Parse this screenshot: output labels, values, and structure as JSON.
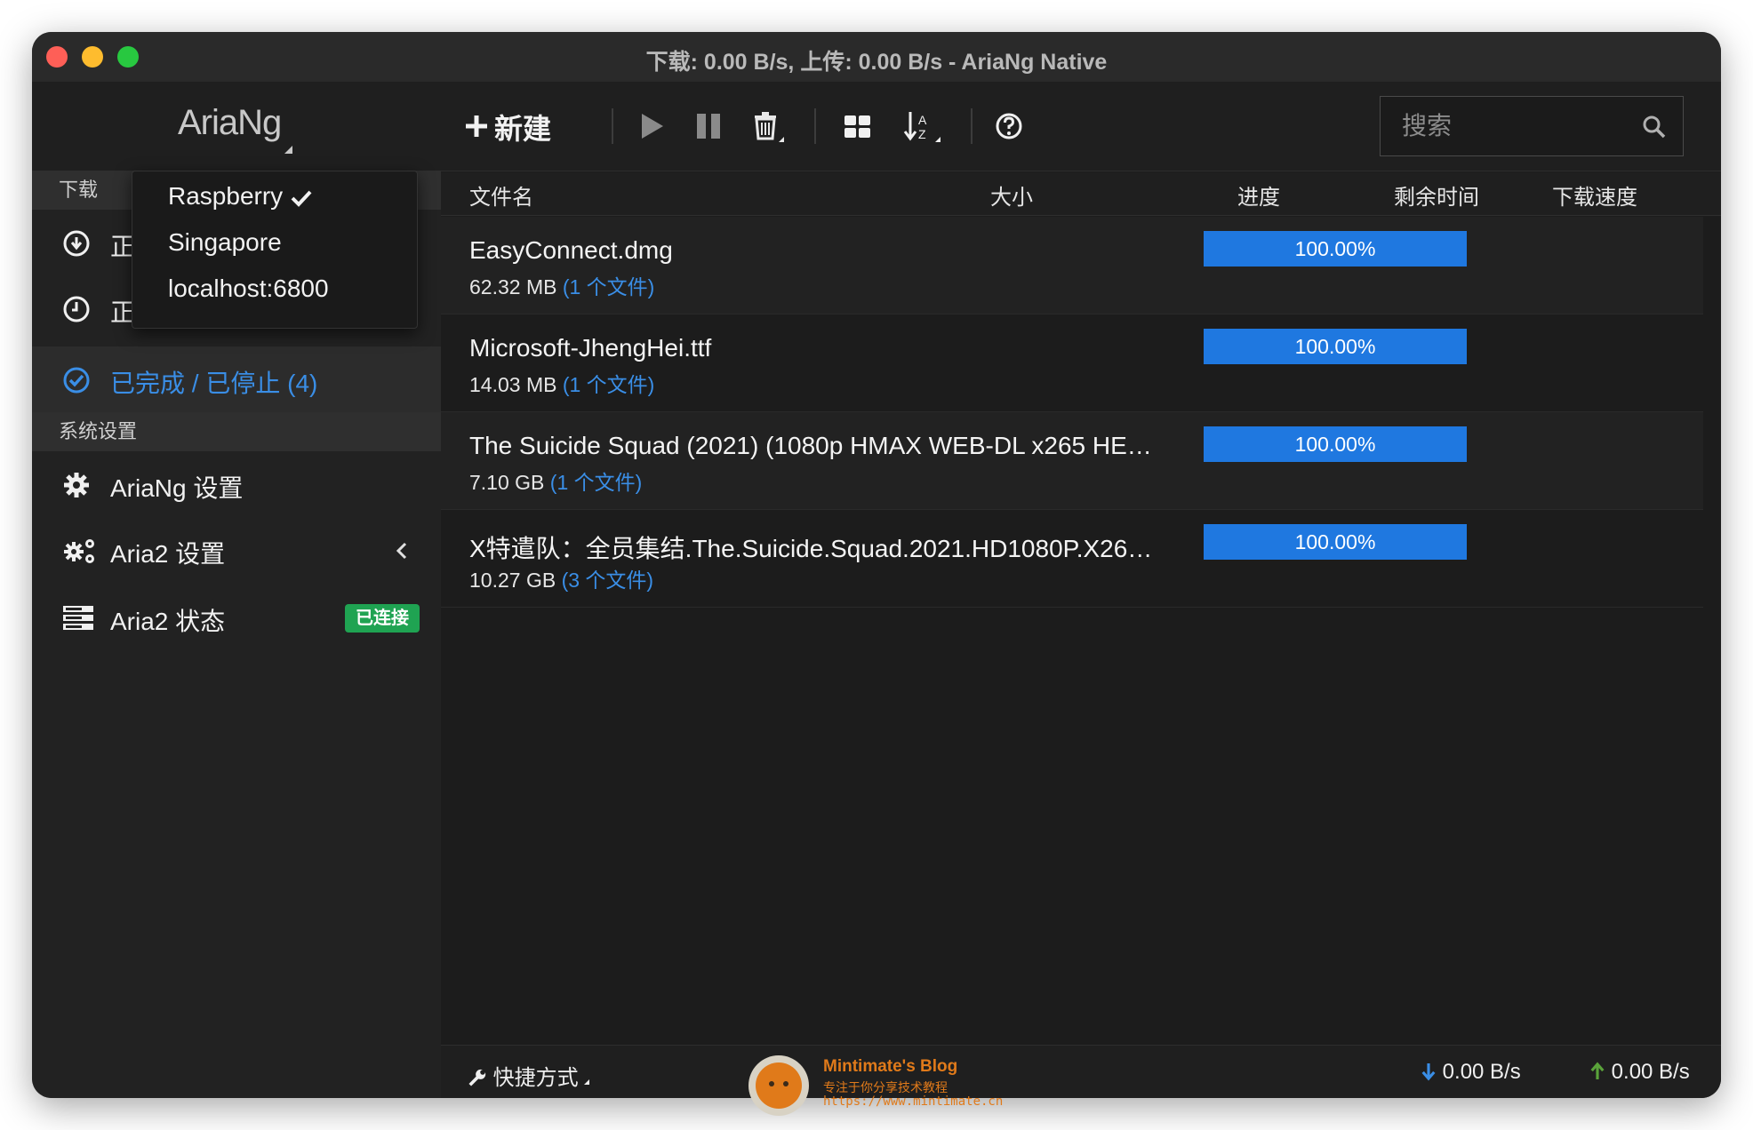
{
  "window": {
    "title": "下载: 0.00 B/s, 上传: 0.00 B/s - AriaNg Native"
  },
  "sidebar": {
    "logo": "AriaNg",
    "download_header": "下载",
    "partial_item_1": "正",
    "partial_item_2": "正",
    "completed_label": "已完成 / 已停止 (4)",
    "settings_header": "系统设置",
    "ariang_settings": "AriaNg 设置",
    "aria2_settings": "Aria2 设置",
    "aria2_status": "Aria2 状态",
    "status_badge": "已连接"
  },
  "rpc_dropdown": {
    "items": [
      "Raspberry",
      "Singapore",
      "localhost:6800"
    ],
    "selected": "Raspberry"
  },
  "toolbar": {
    "new_label": "新建",
    "search_placeholder": "搜索"
  },
  "columns": {
    "name": "文件名",
    "size": "大小",
    "progress": "进度",
    "remaining": "剩余时间",
    "speed": "下载速度"
  },
  "tasks": [
    {
      "name": "EasyConnect.dmg",
      "size": "62.32 MB",
      "files": "(1 个文件)",
      "progress": 100,
      "progress_label": "100.00%"
    },
    {
      "name": "Microsoft-JhengHei.ttf",
      "size": "14.03 MB",
      "files": "(1 个文件)",
      "progress": 100,
      "progress_label": "100.00%"
    },
    {
      "name": "The Suicide Squad (2021) (1080p HMAX WEB-DL x265 HE…",
      "size": "7.10 GB",
      "files": "(1 个文件)",
      "progress": 100,
      "progress_label": "100.00%"
    },
    {
      "name": "X特遣队：全员集结.The.Suicide.Squad.2021.HD1080P.X26…",
      "size": "10.27 GB",
      "files": "(3 个文件)",
      "progress": 100,
      "progress_label": "100.00%"
    }
  ],
  "statusbar": {
    "shortcuts": "快捷方式",
    "download_speed": "0.00 B/s",
    "upload_speed": "0.00 B/s"
  },
  "watermark": {
    "title": "Mintimate's Blog",
    "subtitle": "专注于你分享技术教程",
    "url": "https://www.mintimate.cn"
  },
  "colors": {
    "accent": "#3a8ee6",
    "progress": "#1f78e0",
    "connected": "#1fa352"
  }
}
